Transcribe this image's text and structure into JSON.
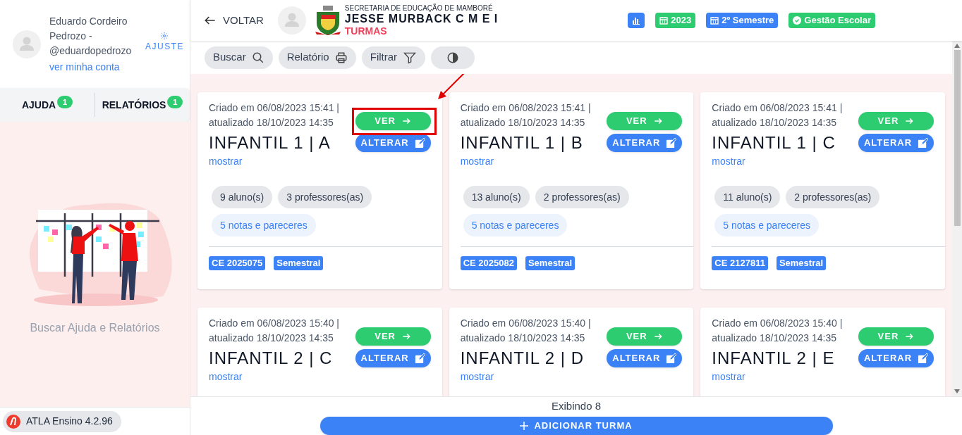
{
  "user": {
    "name": "Eduardo Cordeiro Pedrozo - @eduardopedrozo",
    "account_link": "ver minha conta",
    "settings": "AJUSTE"
  },
  "sidebar_tabs": [
    {
      "label": "AJUDA",
      "badge": "1"
    },
    {
      "label": "RELATÓRIOS",
      "badge": "1"
    }
  ],
  "empty_state": {
    "text": "Buscar Ajuda e Relatórios"
  },
  "version": "ATLA Ensino 4.2.96",
  "header": {
    "back": "VOLTAR",
    "department": "SECRETARIA DE EDUCAÇÃO DE MAMBORÉ",
    "school": "JESSE MURBACK C M E I",
    "page": "TURMAS",
    "chips": [
      {
        "kind": "chart",
        "color": "#3b82f6"
      },
      {
        "kind": "calendar",
        "label": "2023",
        "color": "#2ecc71"
      },
      {
        "kind": "calendar",
        "label": "2º Semestre",
        "color": "#3b82f6"
      },
      {
        "kind": "check",
        "label": "Gestão Escolar",
        "color": "#2ecc71"
      }
    ]
  },
  "toolbar": [
    {
      "kind": "search",
      "label": "Buscar"
    },
    {
      "kind": "print",
      "label": "Relatório"
    },
    {
      "kind": "filter",
      "label": "Filtrar"
    },
    {
      "kind": "contrast"
    }
  ],
  "cards": [
    {
      "created": "Criado em 06/08/2023 15:41 |",
      "updated": "atualizado 18/10/2023 14:35",
      "title": "INFANTIL 1 | A",
      "show": "mostrar",
      "view": "VER",
      "edit": "ALTERAR",
      "highlighted": true,
      "stats": [
        "9 aluno(s)",
        "3 professores(as)"
      ],
      "notes": "5 notas e pareceres",
      "tags": [
        "CE 2025075",
        "Semestral"
      ]
    },
    {
      "created": "Criado em 06/08/2023 15:41 |",
      "updated": "atualizado 18/10/2023 14:35",
      "title": "INFANTIL 1 | B",
      "show": "mostrar",
      "view": "VER",
      "edit": "ALTERAR",
      "highlighted": false,
      "stats": [
        "13 aluno(s)",
        "2 professores(as)"
      ],
      "notes": "5 notas e pareceres",
      "tags": [
        "CE 2025082",
        "Semestral"
      ]
    },
    {
      "created": "Criado em 06/08/2023 15:41 |",
      "updated": "atualizado 18/10/2023 14:35",
      "title": "INFANTIL 1 | C",
      "show": "mostrar",
      "view": "VER",
      "edit": "ALTERAR",
      "highlighted": false,
      "stats": [
        "11 aluno(s)",
        "2 professores(as)"
      ],
      "notes": "5 notas e pareceres",
      "tags": [
        "CE 2127811",
        "Semestral"
      ]
    },
    {
      "created": "Criado em 06/08/2023 15:40 |",
      "updated": "atualizado 18/10/2023 14:35",
      "title": "INFANTIL 2 | C",
      "show": "mostrar",
      "view": "VER",
      "edit": "ALTERAR",
      "highlighted": false
    },
    {
      "created": "Criado em 06/08/2023 15:40 |",
      "updated": "atualizado 18/10/2023 14:35",
      "title": "INFANTIL 2 | D",
      "show": "mostrar",
      "view": "VER",
      "edit": "ALTERAR",
      "highlighted": false
    },
    {
      "created": "Criado em 06/08/2023 15:40 |",
      "updated": "atualizado 18/10/2023 14:35",
      "title": "INFANTIL 2 | E",
      "show": "mostrar",
      "view": "VER",
      "edit": "ALTERAR",
      "highlighted": false
    }
  ],
  "footer": {
    "count": "Exibindo 8",
    "add": "ADICIONAR TURMA"
  }
}
